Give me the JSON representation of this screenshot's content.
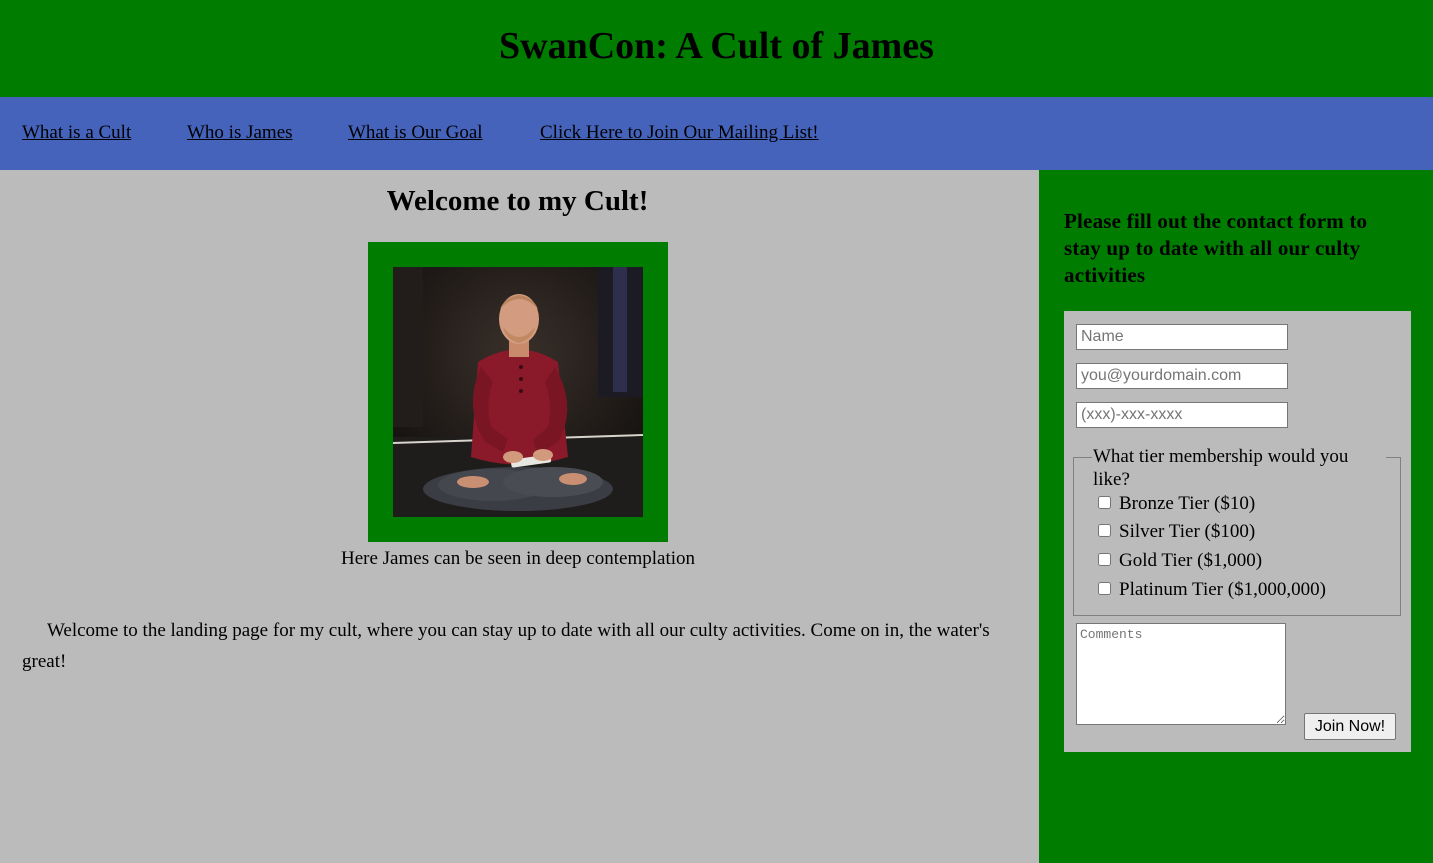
{
  "header": {
    "title": "SwanCon: A Cult of James"
  },
  "nav": {
    "items": [
      {
        "label": "What is a Cult"
      },
      {
        "label": "Who is James"
      },
      {
        "label": "What is Our Goal"
      },
      {
        "label": "Click Here to Join Our Mailing List!"
      }
    ]
  },
  "main": {
    "heading": "Welcome to my Cult!",
    "photo_caption": "Here James can be seen in deep contemplation",
    "intro": "Welcome to the landing page for my cult, where you can stay up to date with all our culty activities. Come on in, the water's great!"
  },
  "sidebar": {
    "heading": "Please fill out the contact form to stay up to date with all our culty activities",
    "form": {
      "name_placeholder": "Name",
      "email_placeholder": "you@yourdomain.com",
      "phone_placeholder": "(xxx)-xxx-xxxx",
      "tier_legend": "What tier membership would you like?",
      "tiers": [
        {
          "label": "Bronze Tier ($10)",
          "checked": false
        },
        {
          "label": "Silver Tier ($100)",
          "checked": false
        },
        {
          "label": "Gold Tier ($1,000)",
          "checked": false
        },
        {
          "label": "Platinum Tier ($1,000,000)",
          "checked": false
        }
      ],
      "comments_placeholder": "Comments",
      "submit_label": "Join Now!"
    }
  },
  "colors": {
    "header_bg": "#007c00",
    "nav_bg": "#4563bb",
    "content_bg": "#bbbbbb",
    "sidebar_bg": "#007c00"
  }
}
